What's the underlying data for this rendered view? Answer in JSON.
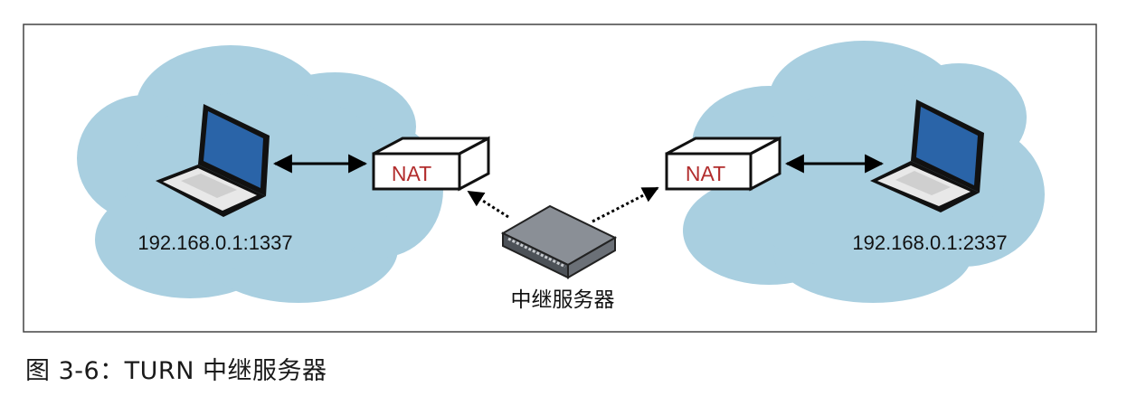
{
  "colors": {
    "cloud": "#a9cfe0",
    "cloud_edge": "#a3cadb",
    "laptop_screen": "#2a64a8",
    "nat_text": "#b22d2d",
    "frame": "#444444",
    "relay_top": "#8a8f96",
    "relay_front": "#5a5f66"
  },
  "diagram": {
    "left_client": {
      "address": "192.168.0.1:1337",
      "icon": "laptop-icon"
    },
    "right_client": {
      "address": "192.168.0.1:2337",
      "icon": "laptop-icon"
    },
    "left_nat": {
      "label": "NAT"
    },
    "right_nat": {
      "label": "NAT"
    },
    "relay": {
      "label": "中继服务器",
      "icon": "relay-server-icon"
    }
  },
  "caption": {
    "text": "图 3-6：TURN 中继服务器"
  }
}
